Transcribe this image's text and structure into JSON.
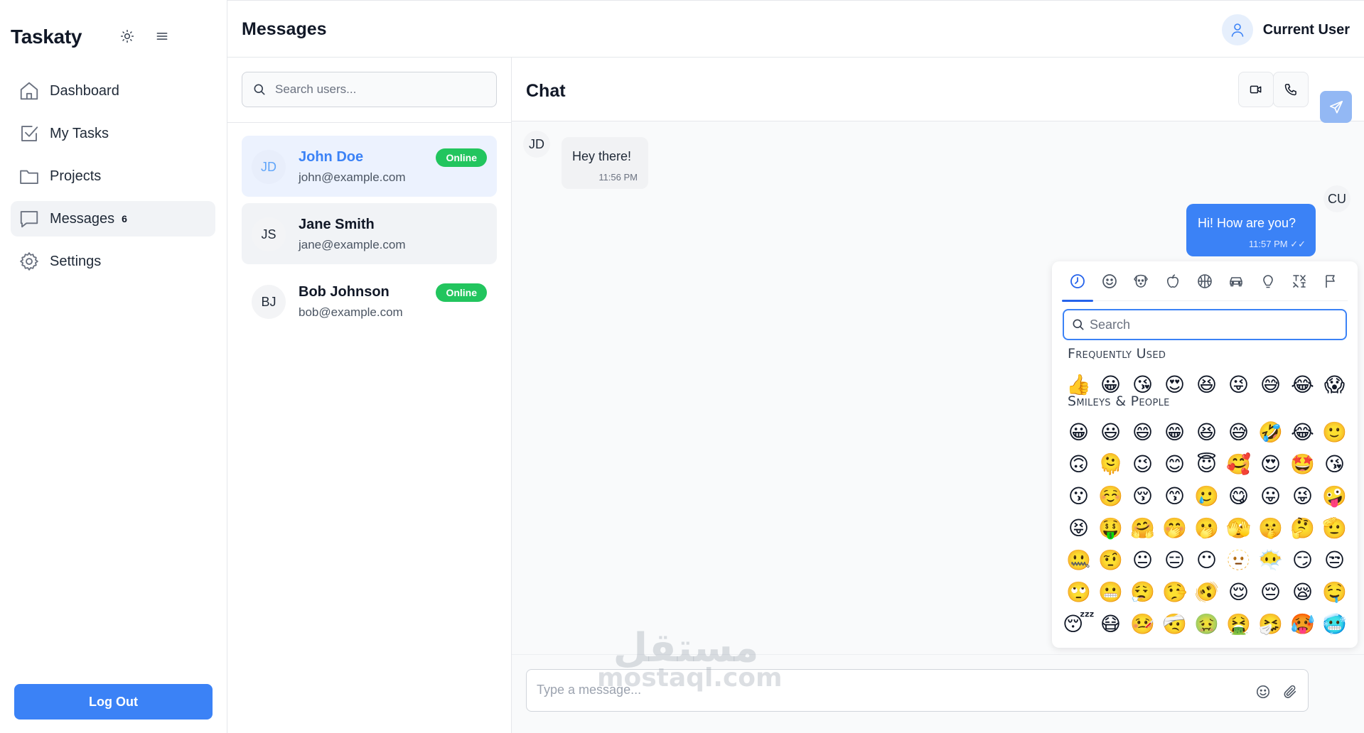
{
  "sidebar": {
    "brand": "Taskaty",
    "theme_icon": "sun-icon",
    "menu_icon": "hamburger-icon",
    "items": [
      {
        "label": "Dashboard",
        "icon": "home-icon"
      },
      {
        "label": "My Tasks",
        "icon": "check-square-icon"
      },
      {
        "label": "Projects",
        "icon": "folder-icon"
      },
      {
        "label": "Messages",
        "icon": "message-icon",
        "badge": "6",
        "active": true
      },
      {
        "label": "Settings",
        "icon": "gear-icon"
      }
    ],
    "logout_label": "Log Out"
  },
  "header": {
    "title": "Messages",
    "user_name": "Current User",
    "user_icon": "user-icon"
  },
  "users": {
    "search_placeholder": "Search users...",
    "list": [
      {
        "initials": "JD",
        "name": "John Doe",
        "email": "john@example.com",
        "status": "Online",
        "selected": true
      },
      {
        "initials": "JS",
        "name": "Jane Smith",
        "email": "jane@example.com",
        "status": ""
      },
      {
        "initials": "BJ",
        "name": "Bob Johnson",
        "email": "bob@example.com",
        "status": "Online"
      }
    ]
  },
  "chat": {
    "title": "Chat",
    "video_icon": "video-icon",
    "call_icon": "phone-icon",
    "messages": [
      {
        "from": "JD",
        "text": "Hey there!",
        "time": "11:56 PM"
      },
      {
        "from": "CU",
        "text": "Hi! How are you?",
        "time": "11:57 PM ✓✓"
      }
    ],
    "input_placeholder": "Type a message...",
    "emoji_button_icon": "smiley-icon",
    "attach_icon": "paperclip-icon",
    "send_icon": "send-icon"
  },
  "watermark": {
    "arabic": "مستقل",
    "latin": "mostaql.com"
  },
  "emoji_picker": {
    "categories": [
      "clock-icon",
      "smiley-icon",
      "dog-icon",
      "apple-icon",
      "basketball-icon",
      "car-icon",
      "lightbulb-icon",
      "symbols-icon",
      "flag-icon"
    ],
    "search_placeholder": "Search",
    "sections": [
      {
        "title": "Frequently Used",
        "emojis": [
          "👍",
          "😀",
          "😘",
          "😍",
          "😆",
          "😜",
          "😅",
          "😂",
          "😱"
        ]
      },
      {
        "title": "Smileys & People",
        "emojis": [
          "😀",
          "😃",
          "😄",
          "😁",
          "😆",
          "😅",
          "🤣",
          "😂",
          "🙂",
          "🙃",
          "🫠",
          "😉",
          "😊",
          "😇",
          "🥰",
          "😍",
          "🤩",
          "😘",
          "😗",
          "☺️",
          "😚",
          "😙",
          "🥲",
          "😋",
          "😛",
          "😜",
          "🤪",
          "😝",
          "🤑",
          "🤗",
          "🤭",
          "🫢",
          "🫣",
          "🤫",
          "🤔",
          "🫡",
          "🤐",
          "🤨",
          "😐",
          "😑",
          "😶",
          "🫥",
          "😶‍🌫️",
          "😏",
          "😒",
          "🙄",
          "😬",
          "😮‍💨",
          "🤥",
          "🫨",
          "😌",
          "😔",
          "😪",
          "🤤",
          "😴",
          "😷",
          "🤒",
          "🤕",
          "🤢",
          "🤮",
          "🤧",
          "🥵",
          "🥶"
        ]
      }
    ]
  }
}
